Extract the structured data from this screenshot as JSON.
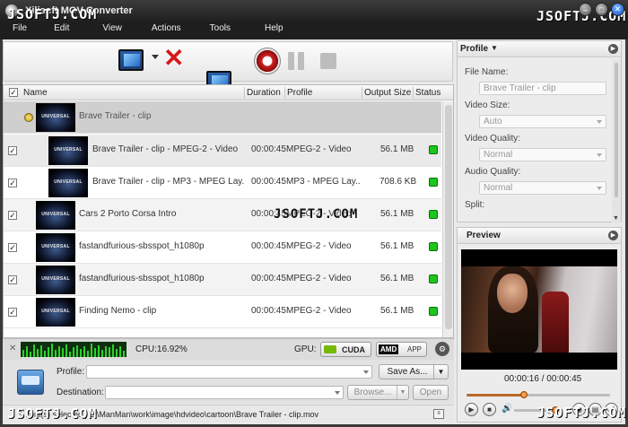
{
  "window": {
    "title": "Xilisoft MOV Converter",
    "watermark": "JSOFTJ.COM"
  },
  "menu": [
    "File",
    "Edit",
    "View",
    "Actions",
    "Tools",
    "Help"
  ],
  "list": {
    "columns": {
      "name": "Name",
      "duration": "Duration",
      "profile": "Profile",
      "output_size": "Output Size",
      "status": "Status"
    },
    "rows": [
      {
        "name": "Brave Trailer - clip",
        "duration": "",
        "profile": "",
        "size": "",
        "thumb": "UNIVERSAL",
        "group": true
      },
      {
        "name": "Brave Trailer - clip - MPEG-2 - Video",
        "duration": "00:00:45",
        "profile": "MPEG-2 - Video",
        "size": "56.1 MB",
        "thumb": "UNIVERSAL"
      },
      {
        "name": "Brave Trailer - clip - MP3 - MPEG Lay...",
        "duration": "00:00:45",
        "profile": "MP3 - MPEG Lay...",
        "size": "708.6 KB",
        "thumb": "UNIVERSAL"
      },
      {
        "name": "Cars 2 Porto Corsa Intro",
        "duration": "00:00:45",
        "profile": "MPEG-2 - Video",
        "size": "56.1 MB",
        "thumb": "UNIVERSAL"
      },
      {
        "name": "fastandfurious-sbsspot_h1080p",
        "duration": "00:00:45",
        "profile": "MPEG-2 - Video",
        "size": "56.1 MB",
        "thumb": "UNIVERSAL"
      },
      {
        "name": "fastandfurious-sbsspot_h1080p",
        "duration": "00:00:45",
        "profile": "MPEG-2 - Video",
        "size": "56.1 MB",
        "thumb": "UNIVERSAL"
      },
      {
        "name": "Finding Nemo - clip",
        "duration": "00:00:45",
        "profile": "MPEG-2 - Video",
        "size": "56.1 MB",
        "thumb": "UNIVERSAL"
      }
    ]
  },
  "monitor": {
    "cpu": "CPU:16.92%",
    "gpu_label": "GPU:",
    "cuda": "CUDA",
    "amd": "AMD",
    "app": "APP"
  },
  "bottom": {
    "profile_label": "Profile:",
    "profile_value": "",
    "save_as": "Save As...",
    "destination_label": "Destination:",
    "destination_value": "",
    "browse": "Browse...",
    "open": "Open",
    "status_text": "1 item(s) selected | E:\\ManMan\\work\\image\\hdvideo\\cartoon\\Brave Trailer - clip.mov"
  },
  "profile_panel": {
    "header": "Profile",
    "file_name_label": "File Name:",
    "file_name_value": "Brave Trailer - clip",
    "video_size_label": "Video Size:",
    "video_size_value": "Auto",
    "video_quality_label": "Video Quality:",
    "video_quality_value": "Normal",
    "audio_quality_label": "Audio Quality:",
    "audio_quality_value": "Normal",
    "split_label": "Split:"
  },
  "preview": {
    "header": "Preview",
    "time": "00:00:16 / 00:00:45",
    "progress": 0.4
  },
  "colors": {
    "titlebar": "#1e1e1e",
    "status_green": "#1ec51e",
    "delete_red": "#d41818"
  }
}
